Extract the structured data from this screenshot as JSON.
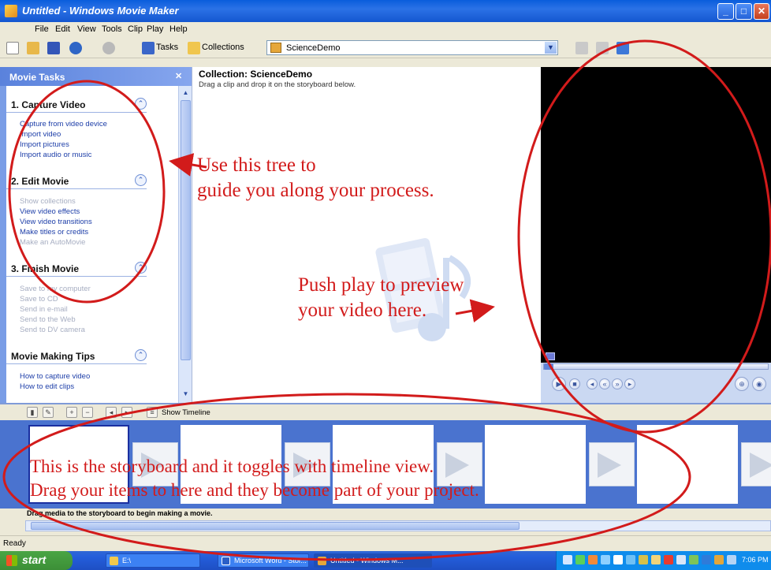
{
  "window": {
    "title": "Untitled - Windows Movie Maker",
    "minimize_glyph": "_",
    "maximize_glyph": "□",
    "close_glyph": "✕"
  },
  "menu": [
    "File",
    "Edit",
    "View",
    "Tools",
    "Clip",
    "Play",
    "Help"
  ],
  "toolbar": {
    "tasks_label": "Tasks",
    "collections_label": "Collections",
    "collection_selected": "ScienceDemo",
    "icons": [
      "new-project-icon",
      "open-project-icon",
      "save-project-icon",
      "undo-icon",
      "redo-icon",
      "up-folder-icon",
      "new-folder-icon",
      "views-icon"
    ]
  },
  "task_pane": {
    "header": "Movie Tasks",
    "groups": [
      {
        "title": "1. Capture Video",
        "items": [
          {
            "label": "Capture from video device",
            "enabled": true
          },
          {
            "label": "Import video",
            "enabled": true
          },
          {
            "label": "Import pictures",
            "enabled": true
          },
          {
            "label": "Import audio or music",
            "enabled": true
          }
        ]
      },
      {
        "title": "2. Edit Movie",
        "items": [
          {
            "label": "Show collections",
            "enabled": false
          },
          {
            "label": "View video effects",
            "enabled": true
          },
          {
            "label": "View video transitions",
            "enabled": true
          },
          {
            "label": "Make titles or credits",
            "enabled": true
          },
          {
            "label": "Make an AutoMovie",
            "enabled": false
          }
        ]
      },
      {
        "title": "3. Finish Movie",
        "items": [
          {
            "label": "Save to my computer",
            "enabled": false
          },
          {
            "label": "Save to CD",
            "enabled": false
          },
          {
            "label": "Send in e-mail",
            "enabled": false
          },
          {
            "label": "Send to the Web",
            "enabled": false
          },
          {
            "label": "Send to DV camera",
            "enabled": false
          }
        ]
      },
      {
        "title": "Movie Making Tips",
        "items": [
          {
            "label": "How to capture video",
            "enabled": true
          },
          {
            "label": "How to edit clips",
            "enabled": true
          }
        ]
      }
    ]
  },
  "collection": {
    "title": "Collection: ScienceDemo",
    "subtitle": "Drag a clip and drop it on the storyboard below."
  },
  "storyboard": {
    "show_timeline_label": "Show Timeline",
    "hint": "Drag media to the storyboard to begin making a movie."
  },
  "status": {
    "text": "Ready"
  },
  "taskbar": {
    "start_label": "start",
    "buttons": [
      "E:\\",
      "Microsoft Word - Stor...",
      "Untitled - Windows M..."
    ],
    "clock": "7:06 PM"
  },
  "annotations": {
    "tree_line1": "Use this tree to",
    "tree_line2": "guide you along your process.",
    "preview_line1": "Push play to preview",
    "preview_line2": "your video here.",
    "storyboard_line1": "This is the storyboard and it toggles with timeline view.",
    "storyboard_line2": "Drag your items to here and they become part of your project."
  },
  "colors": {
    "annotation": "#d21b1b",
    "titlebar": "#0a5ddc",
    "storyboard_bg": "#4a73cf",
    "monitor": "#000000"
  }
}
